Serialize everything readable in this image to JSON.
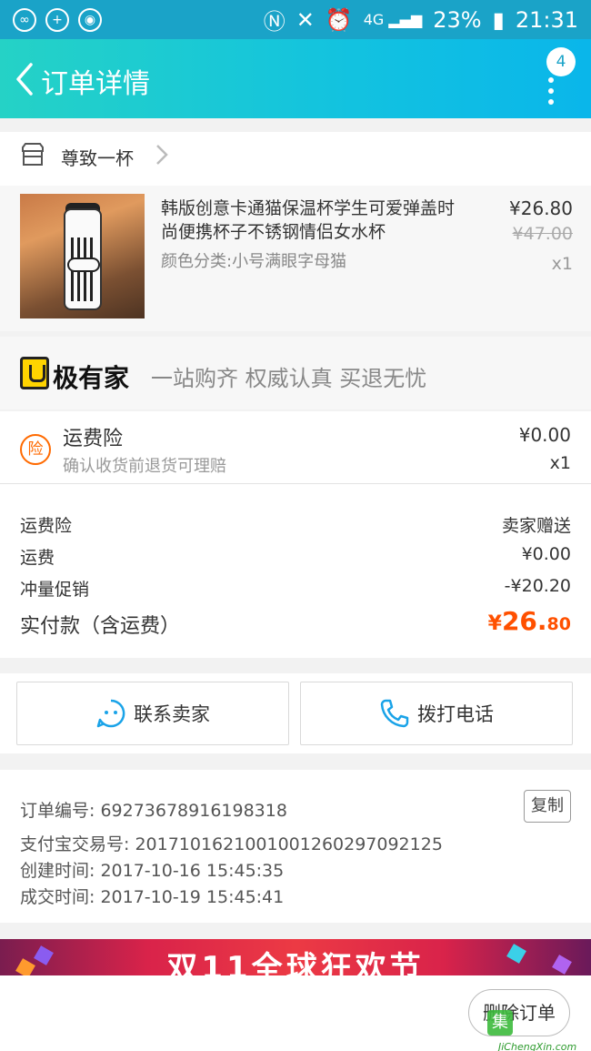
{
  "status_bar": {
    "battery": "23%",
    "time": "21:31"
  },
  "header": {
    "title": "订单详情",
    "badge": "4"
  },
  "shop": {
    "name": "尊致一杯"
  },
  "product": {
    "title": "韩版创意卡通猫保温杯学生可爱弹盖时尚便携杯子不锈钢情侣女水杯",
    "sku": "颜色分类:小号满眼字母猫",
    "price": "¥26.80",
    "original_price": "¥47.00",
    "quantity": "x1"
  },
  "jiyoujia": {
    "name": "极有家",
    "slogan": "一站购齐 权威认真 买退无忧"
  },
  "insurance": {
    "icon_char": "险",
    "name": "运费险",
    "desc": "确认收货前退货可理赔",
    "price": "¥0.00",
    "quantity": "x1"
  },
  "summary": {
    "rows": [
      {
        "label": "运费险",
        "value": "卖家赠送"
      },
      {
        "label": "运费",
        "value": "¥0.00"
      },
      {
        "label": "冲量促销",
        "value": "-¥20.20"
      }
    ],
    "total_label": "实付款（含运费）",
    "total_currency": "¥",
    "total_int": "26.",
    "total_dec": "80"
  },
  "actions": {
    "contact_seller": "联系卖家",
    "call_phone": "拨打电话"
  },
  "order_info": {
    "order_no": "订单编号: 69273678916198318",
    "alipay_no": "支付宝交易号: 2017101621001001260297092125",
    "created": "创建时间: 2017-10-16 15:45:35",
    "completed": "成交时间: 2017-10-19 15:45:41",
    "copy_label": "复制"
  },
  "promo": {
    "text": "双11全球狂欢节"
  },
  "bottom": {
    "delete_label": "删除订单"
  },
  "watermark": {
    "mark": "集",
    "site": "JiChengXin.com"
  },
  "colors": {
    "header_start": "#25d2c6",
    "header_end": "#0ab6ea",
    "accent_price": "#ff5000",
    "insurance_icon": "#ff6a00"
  }
}
